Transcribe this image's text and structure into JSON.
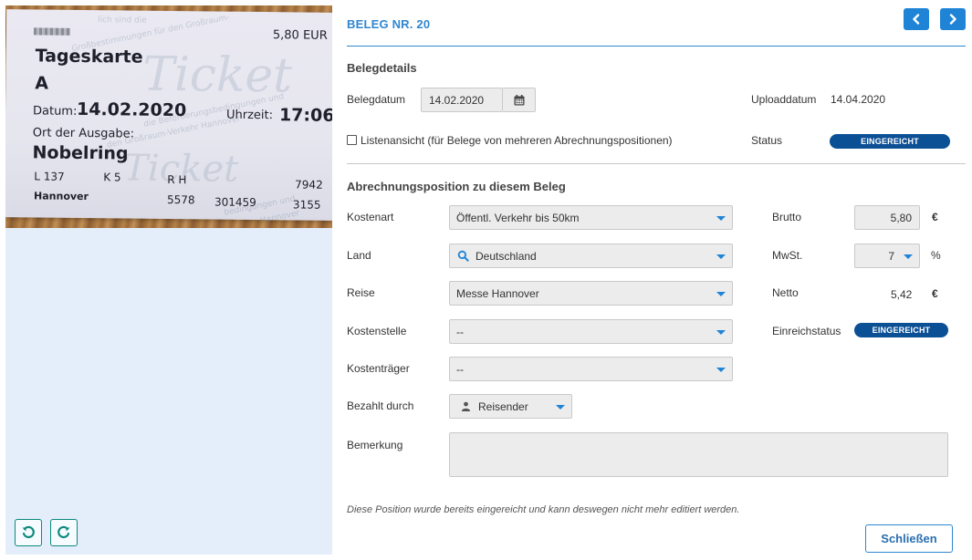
{
  "receipt_image": {
    "operator_line": "lich sind die",
    "price": "5,80 EUR",
    "ticket_type": "Tageskarte",
    "zone": "A",
    "date_label": "Datum:",
    "date_value": "14.02.2020",
    "time_label": "Uhrzeit:",
    "time_value": "17:06",
    "issue_label": "Ort der Ausgabe:",
    "issue_place": "Nobelring",
    "row1": [
      "L 137",
      "K 5",
      "R H",
      "7942"
    ],
    "row2": [
      "Hannover",
      "5578",
      "301459",
      "3155"
    ],
    "watermark": "Ticket",
    "fine_print_1": "Großbestimmungen für den Großraum-",
    "fine_print_2": "die Beförderungsbedingungen und",
    "fine_print_3": "den Großraum-Verkehr Hannover",
    "fine_print_4": "bedingungen und",
    "fine_print_5": "Hannover"
  },
  "image_toolbar": {
    "rotate_left_icon": "rotate-ccw-icon",
    "rotate_right_icon": "rotate-cw-icon"
  },
  "header": {
    "title": "BELEG NR. 20",
    "prev_icon": "chevron-left-icon",
    "next_icon": "chevron-right-icon"
  },
  "belegdetails": {
    "heading": "Belegdetails",
    "belegdatum_label": "Belegdatum",
    "belegdatum_value": "14.02.2020",
    "calendar_icon": "calendar-icon",
    "uploaddatum_label": "Uploaddatum",
    "uploaddatum_value": "14.04.2020",
    "listenansicht_label": "Listenansicht (für Belege von mehreren Abrechnungspositionen)",
    "listenansicht_checked": false,
    "status_label": "Status",
    "status_value": "EINGEREICHT"
  },
  "abrechnung": {
    "heading": "Abrechnungsposition zu diesem Beleg",
    "kostenart_label": "Kostenart",
    "kostenart_value": "Öffentl. Verkehr bis 50km",
    "land_label": "Land",
    "land_value": "Deutschland",
    "reise_label": "Reise",
    "reise_value": "Messe Hannover",
    "kostenstelle_label": "Kostenstelle",
    "kostenstelle_value": "--",
    "kostentraeger_label": "Kostenträger",
    "kostentraeger_value": "--",
    "bezahlt_label": "Bezahlt durch",
    "bezahlt_value": "Reisender",
    "bemerkung_label": "Bemerkung",
    "bemerkung_value": "",
    "brutto_label": "Brutto",
    "brutto_value": "5,80",
    "currency": "€",
    "mwst_label": "MwSt.",
    "mwst_value": "7",
    "percent": "%",
    "netto_label": "Netto",
    "netto_value": "5,42",
    "einreichstatus_label": "Einreichstatus",
    "einreichstatus_value": "EINGEREICHT"
  },
  "footer": {
    "note": "Diese Position wurde bereits eingereicht und kann deswegen nicht mehr editiert werden.",
    "close_label": "Schließen"
  },
  "colors": {
    "accent": "#1f84d6",
    "badge": "#0b4f95",
    "rotate_btn": "#0a8a7a",
    "left_pane_bg": "#e4eefb"
  }
}
